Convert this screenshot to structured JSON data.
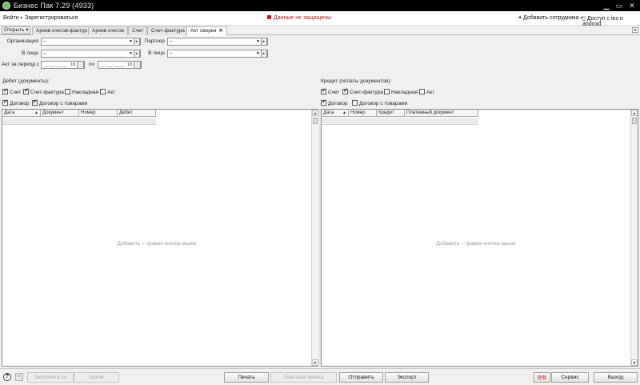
{
  "window": {
    "title": "Бизнес Пак 7.29 (4933)"
  },
  "menubar": {
    "login": "Войти ▪",
    "register": "Зарегистрироваться",
    "warning": "Данные не защищены",
    "add_employee": "Добавить сотрудника ▪",
    "mobile_access": "Доступ с ios и android"
  },
  "tabs": {
    "open_button": "Открыть",
    "items": [
      {
        "label": "Архив счетов-фактур"
      },
      {
        "label": "Архив счетов"
      },
      {
        "label": "Счет"
      },
      {
        "label": "Счет-фактура"
      },
      {
        "label": "Акт сверки"
      }
    ],
    "active_index": 4
  },
  "filters": {
    "organization_label": "Организация",
    "organization_value": "–",
    "in_person_label": "В лице",
    "in_person_value": "–",
    "partner_label": "Партнер",
    "partner_value": "–",
    "partner_in_person_label": "В лице",
    "partner_in_person_value": "–",
    "period_label": "Акт за период с",
    "date_from": "__.__.____",
    "date_from_num": "18",
    "to_label": "по",
    "date_to": "__.__.____",
    "date_to_num": "18"
  },
  "debit": {
    "title": "Дебет (документы):",
    "checkboxes": [
      {
        "label": "Счет",
        "checked": true
      },
      {
        "label": "Счет-фактура",
        "checked": true
      },
      {
        "label": "Накладная",
        "checked": false
      },
      {
        "label": "Акт",
        "checked": false
      },
      {
        "label": "Договор",
        "checked": true
      },
      {
        "label": "Договор с товарами",
        "checked": true
      }
    ],
    "columns": [
      "Дата",
      "Документ",
      "Номер",
      "Дебет"
    ],
    "hint": "Добавить – правая кнопка мыши"
  },
  "credit": {
    "title": "Кредит (оплаты документов):",
    "checkboxes": [
      {
        "label": "Счет",
        "checked": true
      },
      {
        "label": "Счет-фактура",
        "checked": true
      },
      {
        "label": "Накладная",
        "checked": false
      },
      {
        "label": "Акт",
        "checked": false
      },
      {
        "label": "Договор",
        "checked": true
      },
      {
        "label": "Договор с товарами",
        "checked": false
      }
    ],
    "columns": [
      "Дата",
      "Номер",
      "Кредит",
      "Платежный документ"
    ],
    "hint": "Добавить – правая кнопка мыши"
  },
  "bottom": {
    "fill_from": "Заполнить по",
    "archive": "Архив",
    "print": "Печать",
    "batch_print": "Пакетная печать",
    "send": "Отправить",
    "export": "Экспорт",
    "radio": "((•))",
    "service": "Сервис",
    "exit": "Выход"
  }
}
